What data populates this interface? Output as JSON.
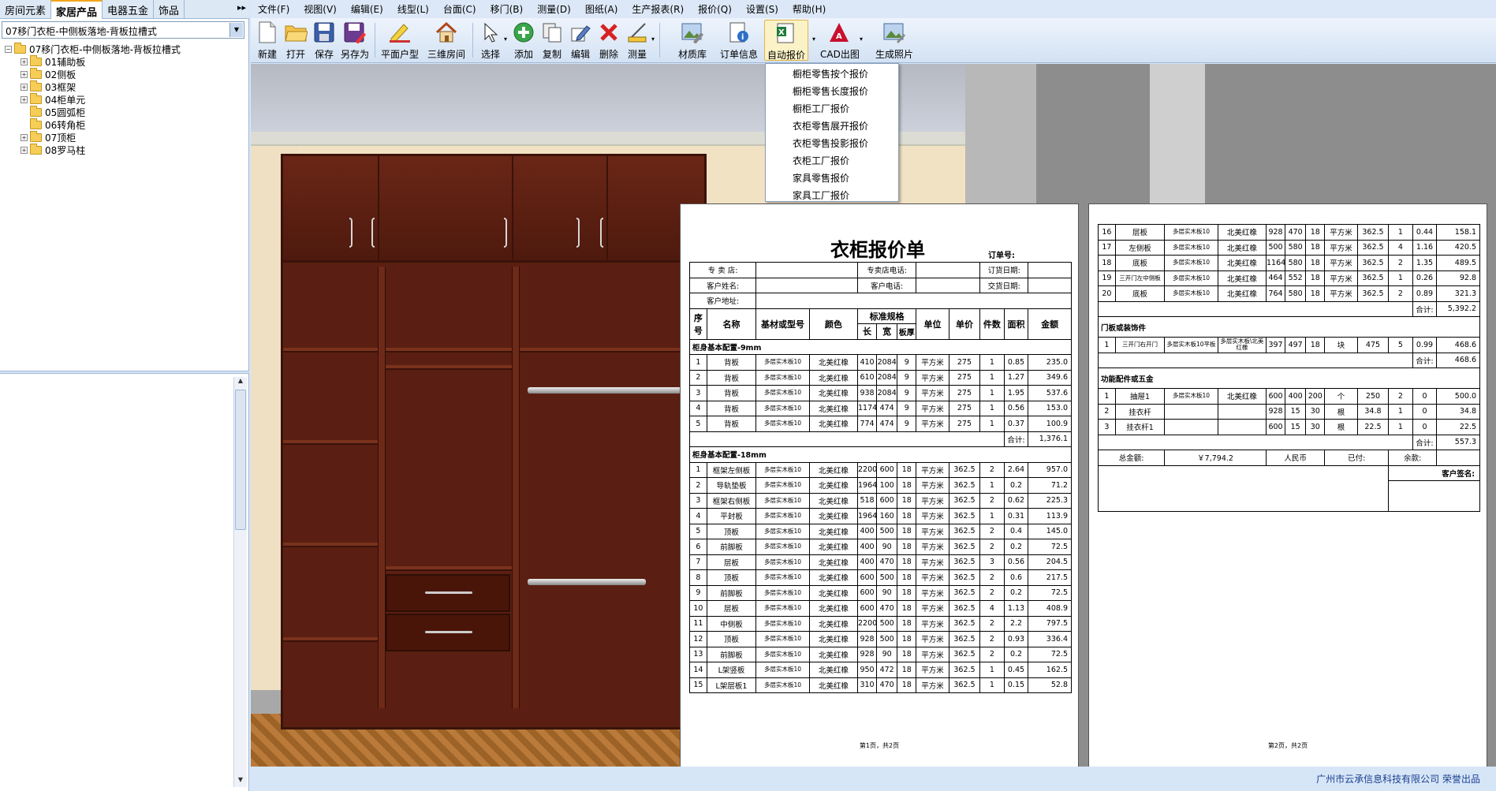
{
  "left_tabs": [
    "房间元素",
    "家居产品",
    "电器五金",
    "饰品"
  ],
  "tab_more": "▸▸",
  "combo_value": "07移门衣柜-中侧板落地-背板拉槽式",
  "tree": {
    "root": "07移门衣柜-中侧板落地-背板拉槽式",
    "items": [
      "01辅助板",
      "02侧板",
      "03框架",
      "04柜单元",
      "05圆弧柜",
      "06转角柜",
      "07顶柜",
      "08罗马柱"
    ],
    "expandable": [
      true,
      true,
      true,
      true,
      false,
      false,
      true,
      true
    ]
  },
  "menus": [
    "文件(F)",
    "视图(V)",
    "编辑(E)",
    "线型(L)",
    "台面(C)",
    "移门(B)",
    "测量(D)",
    "图纸(A)",
    "生产报表(R)",
    "报价(Q)",
    "设置(S)",
    "帮助(H)"
  ],
  "toolbar": [
    "新建",
    "打开",
    "保存",
    "另存为",
    "平面户型",
    "三维房间",
    "选择",
    "添加",
    "复制",
    "编辑",
    "删除",
    "测量",
    "材质库",
    "订单信息",
    "自动报价",
    "CAD出图",
    "生成照片"
  ],
  "dropdown": [
    "橱柜零售按个报价",
    "橱柜零售长度报价",
    "橱柜工厂报价",
    "衣柜零售展开报价",
    "衣柜零售投影报价",
    "衣柜工厂报价",
    "家具零售报价",
    "家具工厂报价"
  ],
  "report": {
    "title": "衣柜报价单",
    "order_no": "订单号:",
    "info": {
      "store": "专 卖 店:",
      "store_phone": "专卖店电话:",
      "order_date": "订货日期:",
      "customer": "客户姓名:",
      "customer_phone": "客户电话:",
      "delivery_date": "交货日期:",
      "address": "客户地址:"
    },
    "headers": {
      "no": "序号",
      "name": "名称",
      "material": "基材或型号",
      "color": "颜色",
      "spec": "标准规格",
      "len": "长",
      "wid": "宽",
      "thk": "板厚",
      "unit": "单位",
      "price": "单价",
      "qty": "件数",
      "area": "面积",
      "amount": "金额"
    },
    "section1": "柜身基本配置-9mm",
    "rows1": [
      [
        "1",
        "背板",
        "多层实木板10",
        "北美红橡",
        "410",
        "2084",
        "9",
        "平方米",
        "275",
        "1",
        "0.85",
        "235.0"
      ],
      [
        "2",
        "背板",
        "多层实木板10",
        "北美红橡",
        "610",
        "2084",
        "9",
        "平方米",
        "275",
        "1",
        "1.27",
        "349.6"
      ],
      [
        "3",
        "背板",
        "多层实木板10",
        "北美红橡",
        "938",
        "2084",
        "9",
        "平方米",
        "275",
        "1",
        "1.95",
        "537.6"
      ],
      [
        "4",
        "背板",
        "多层实木板10",
        "北美红橡",
        "1174",
        "474",
        "9",
        "平方米",
        "275",
        "1",
        "0.56",
        "153.0"
      ],
      [
        "5",
        "背板",
        "多层实木板10",
        "北美红橡",
        "774",
        "474",
        "9",
        "平方米",
        "275",
        "1",
        "0.37",
        "100.9"
      ]
    ],
    "subtotal_label": "合计:",
    "subtotal1": "1,376.1",
    "section2": "柜身基本配置-18mm",
    "rows2": [
      [
        "1",
        "框架左侧板",
        "多层实木板10",
        "北美红橡",
        "2200",
        "600",
        "18",
        "平方米",
        "362.5",
        "2",
        "2.64",
        "957.0"
      ],
      [
        "2",
        "导轨垫板",
        "多层实木板10",
        "北美红橡",
        "1964",
        "100",
        "18",
        "平方米",
        "362.5",
        "1",
        "0.2",
        "71.2"
      ],
      [
        "3",
        "框架右侧板",
        "多层实木板10",
        "北美红橡",
        "518",
        "600",
        "18",
        "平方米",
        "362.5",
        "2",
        "0.62",
        "225.3"
      ],
      [
        "4",
        "平封板",
        "多层实木板10",
        "北美红橡",
        "1964",
        "160",
        "18",
        "平方米",
        "362.5",
        "1",
        "0.31",
        "113.9"
      ],
      [
        "5",
        "顶板",
        "多层实木板10",
        "北美红橡",
        "400",
        "500",
        "18",
        "平方米",
        "362.5",
        "2",
        "0.4",
        "145.0"
      ],
      [
        "6",
        "前脚板",
        "多层实木板10",
        "北美红橡",
        "400",
        "90",
        "18",
        "平方米",
        "362.5",
        "2",
        "0.2",
        "72.5"
      ],
      [
        "7",
        "层板",
        "多层实木板10",
        "北美红橡",
        "400",
        "470",
        "18",
        "平方米",
        "362.5",
        "3",
        "0.56",
        "204.5"
      ],
      [
        "8",
        "顶板",
        "多层实木板10",
        "北美红橡",
        "600",
        "500",
        "18",
        "平方米",
        "362.5",
        "2",
        "0.6",
        "217.5"
      ],
      [
        "9",
        "前脚板",
        "多层实木板10",
        "北美红橡",
        "600",
        "90",
        "18",
        "平方米",
        "362.5",
        "2",
        "0.2",
        "72.5"
      ],
      [
        "10",
        "层板",
        "多层实木板10",
        "北美红橡",
        "600",
        "470",
        "18",
        "平方米",
        "362.5",
        "4",
        "1.13",
        "408.9"
      ],
      [
        "11",
        "中侧板",
        "多层实木板10",
        "北美红橡",
        "2200",
        "500",
        "18",
        "平方米",
        "362.5",
        "2",
        "2.2",
        "797.5"
      ],
      [
        "12",
        "顶板",
        "多层实木板10",
        "北美红橡",
        "928",
        "500",
        "18",
        "平方米",
        "362.5",
        "2",
        "0.93",
        "336.4"
      ],
      [
        "13",
        "前脚板",
        "多层实木板10",
        "北美红橡",
        "928",
        "90",
        "18",
        "平方米",
        "362.5",
        "2",
        "0.2",
        "72.5"
      ],
      [
        "14",
        "L架竖板",
        "多层实木板10",
        "北美红橡",
        "950",
        "472",
        "18",
        "平方米",
        "362.5",
        "1",
        "0.45",
        "162.5"
      ],
      [
        "15",
        "L架层板1",
        "多层实木板10",
        "北美红橡",
        "310",
        "470",
        "18",
        "平方米",
        "362.5",
        "1",
        "0.15",
        "52.8"
      ]
    ],
    "page1_footer": "第1页，共2页",
    "rows2b": [
      [
        "16",
        "层板",
        "多层实木板10",
        "北美红橡",
        "928",
        "470",
        "18",
        "平方米",
        "362.5",
        "1",
        "0.44",
        "158.1"
      ],
      [
        "17",
        "左侧板",
        "多层实木板10",
        "北美红橡",
        "500",
        "580",
        "18",
        "平方米",
        "362.5",
        "4",
        "1.16",
        "420.5"
      ],
      [
        "18",
        "底板",
        "多层实木板10",
        "北美红橡",
        "1164",
        "580",
        "18",
        "平方米",
        "362.5",
        "2",
        "1.35",
        "489.5"
      ],
      [
        "19",
        "三开门左中侧板",
        "多层实木板10",
        "北美红橡",
        "464",
        "552",
        "18",
        "平方米",
        "362.5",
        "1",
        "0.26",
        "92.8"
      ],
      [
        "20",
        "底板",
        "多层实木板10",
        "北美红橡",
        "764",
        "580",
        "18",
        "平方米",
        "362.5",
        "2",
        "0.89",
        "321.3"
      ]
    ],
    "subtotal2": "5,392.2",
    "section3": "门板或装饰件",
    "rows3": [
      [
        "1",
        "三开门右开门",
        "多层实木板10平板",
        "多层实木板\\北美红橡",
        "397",
        "497",
        "18",
        "块",
        "475",
        "5",
        "0.99",
        "468.6"
      ]
    ],
    "subtotal3": "468.6",
    "section4": "功能配件或五金",
    "rows4": [
      [
        "1",
        "抽屉1",
        "多层实木板10",
        "北美红橡",
        "600",
        "400",
        "200",
        "个",
        "250",
        "2",
        "0",
        "500.0"
      ],
      [
        "2",
        "挂衣杆",
        "",
        "",
        "928",
        "15",
        "30",
        "根",
        "34.8",
        "1",
        "0",
        "34.8"
      ],
      [
        "3",
        "挂衣杆1",
        "",
        "",
        "600",
        "15",
        "30",
        "根",
        "22.5",
        "1",
        "0",
        "22.5"
      ]
    ],
    "subtotal4": "557.3",
    "total_label": "总金额:",
    "total_value": "￥7,794.2",
    "currency": "人民币",
    "paid_label": "已付:",
    "balance_label": "余款:",
    "signature": "客户签名:",
    "page2_footer": "第2页，共2页"
  },
  "company": "广州市云承信息科技有限公司 荣誉出品"
}
